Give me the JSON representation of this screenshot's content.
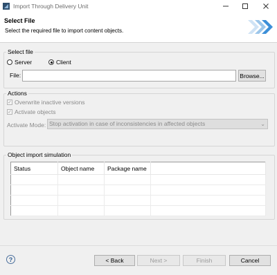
{
  "window": {
    "title": "Import Through Delivery Unit",
    "minimize_icon": "minimize-icon",
    "maximize_icon": "maximize-icon",
    "close_icon": "close-icon"
  },
  "header": {
    "title": "Select File",
    "description": "Select the required file to import content objects.",
    "logo_icon": "double-chevron-icon"
  },
  "select_file": {
    "legend": "Select file",
    "options": [
      {
        "label": "Server",
        "selected": false
      },
      {
        "label": "Client",
        "selected": true
      }
    ],
    "file_label": "File:",
    "file_value": "",
    "browse_label": "Browse..."
  },
  "actions": {
    "legend": "Actions",
    "overwrite_label": "Overwrite inactive versions",
    "overwrite_checked": true,
    "activate_label": "Activate objects",
    "activate_checked": true,
    "mode_label": "Activate Mode:",
    "mode_value": "Stop activation in case of inconsistencies in affected objects"
  },
  "simulation": {
    "legend": "Object import simulation",
    "columns": [
      "Status",
      "Object name",
      "Package name",
      ""
    ],
    "rows": [
      [
        "",
        "",
        "",
        ""
      ],
      [
        "",
        "",
        "",
        ""
      ],
      [
        "",
        "",
        "",
        ""
      ],
      [
        "",
        "",
        "",
        ""
      ]
    ]
  },
  "footer": {
    "help_icon": "help-icon",
    "back_label": "< Back",
    "next_label": "Next >",
    "finish_label": "Finish",
    "cancel_label": "Cancel"
  },
  "colors": {
    "accent": "#3c8fd8",
    "window_bg": "#f0f0f0"
  }
}
